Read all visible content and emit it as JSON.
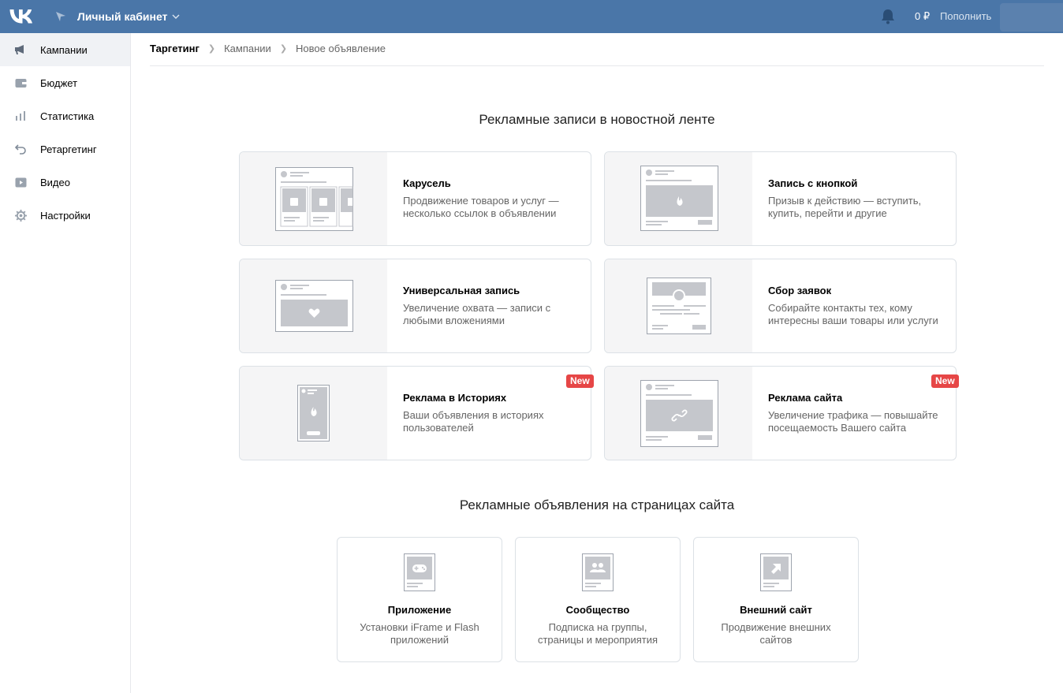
{
  "header": {
    "cabinet_label": "Личный кабинет",
    "balance": "0 ₽",
    "topup_label": "Пополнить"
  },
  "sidebar": {
    "items": [
      {
        "label": "Кампании",
        "icon": "megaphone-icon"
      },
      {
        "label": "Бюджет",
        "icon": "wallet-icon"
      },
      {
        "label": "Статистика",
        "icon": "bar-chart-icon"
      },
      {
        "label": "Ретаргетинг",
        "icon": "undo-arrow-icon"
      },
      {
        "label": "Видео",
        "icon": "play-icon"
      },
      {
        "label": "Настройки",
        "icon": "gear-icon"
      }
    ]
  },
  "breadcrumbs": [
    "Таргетинг",
    "Кампании",
    "Новое объявление"
  ],
  "feed": {
    "title": "Рекламные записи в новостной ленте",
    "cards": [
      {
        "title": "Карусель",
        "desc": "Продвижение товаров и услуг — несколько ссылок в объявлении"
      },
      {
        "title": "Запись с кнопкой",
        "desc": "Призыв к действию — вступить, купить, перейти и другие"
      },
      {
        "title": "Универсальная запись",
        "desc": "Увеличение охвата — записи с любыми вложениями"
      },
      {
        "title": "Сбор заявок",
        "desc": "Собирайте контакты тех, кому интересны ваши товары или услуги"
      },
      {
        "title": "Реклама в Историях",
        "desc": "Ваши объявления в историях пользователей",
        "badge": "New"
      },
      {
        "title": "Реклама сайта",
        "desc": "Увеличение трафика — повышайте посещаемость Вашего сайта",
        "badge": "New"
      }
    ]
  },
  "site": {
    "title": "Рекламные объявления на страницах сайта",
    "cards": [
      {
        "title": "Приложение",
        "desc": "Установки iFrame и Flash приложений",
        "icon": "gamepad-icon"
      },
      {
        "title": "Сообщество",
        "desc": "Подписка на группы, страницы и мероприятия",
        "icon": "people-icon"
      },
      {
        "title": "Внешний сайт",
        "desc": "Продвижение внешних сайтов",
        "icon": "external-arrow-icon"
      }
    ]
  },
  "colors": {
    "header_bg": "#4a76a8",
    "badge": "#e64646",
    "illus_gray": "#c5c7cc"
  }
}
